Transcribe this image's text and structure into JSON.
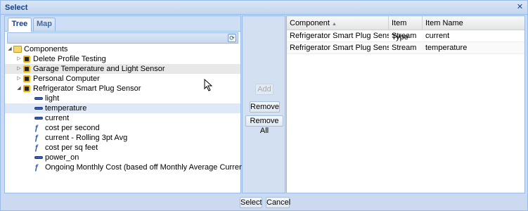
{
  "dialog": {
    "title": "Select",
    "close_glyph": "✕"
  },
  "tabs": [
    {
      "label": "Tree"
    },
    {
      "label": "Map"
    }
  ],
  "tree": {
    "root": "Components",
    "devices": [
      "Delete Profile Testing",
      "Garage Temperature and Light Sensor",
      "Personal Computer",
      "Refrigerator Smart Plug Sensor"
    ],
    "children": [
      {
        "label": "light",
        "icon": "stream-icon"
      },
      {
        "label": "temperature",
        "icon": "stream-icon"
      },
      {
        "label": "current",
        "icon": "stream-icon"
      },
      {
        "label": "cost per second",
        "icon": "calculated-stream-icon"
      },
      {
        "label": "current - Rolling 3pt Avg",
        "icon": "calculated-stream-icon"
      },
      {
        "label": "cost per sq feet",
        "icon": "calculated-stream-icon"
      },
      {
        "label": "power_on",
        "icon": "stream-icon"
      },
      {
        "label": "Ongoing Monthly Cost (based off Monthly Average Current)",
        "icon": "calculated-stream-icon"
      }
    ]
  },
  "actions": {
    "add": "Add",
    "remove": "Remove",
    "remove_all": "Remove All"
  },
  "grid": {
    "columns": {
      "component": "Component",
      "sort_glyph": "▲",
      "item_type": "Item Type",
      "item_name": "Item Name"
    },
    "rows": [
      {
        "component": "Refrigerator Smart Plug Sensor",
        "item_type": "Stream",
        "item_name": "current"
      },
      {
        "component": "Refrigerator Smart Plug Sensor",
        "item_type": "Stream",
        "item_name": "temperature"
      }
    ]
  },
  "footer": {
    "select": "Select",
    "cancel": "Cancel"
  },
  "colors": {
    "title": "#15428b",
    "border": "#99bbe8",
    "selection": "#dfe8f6"
  }
}
